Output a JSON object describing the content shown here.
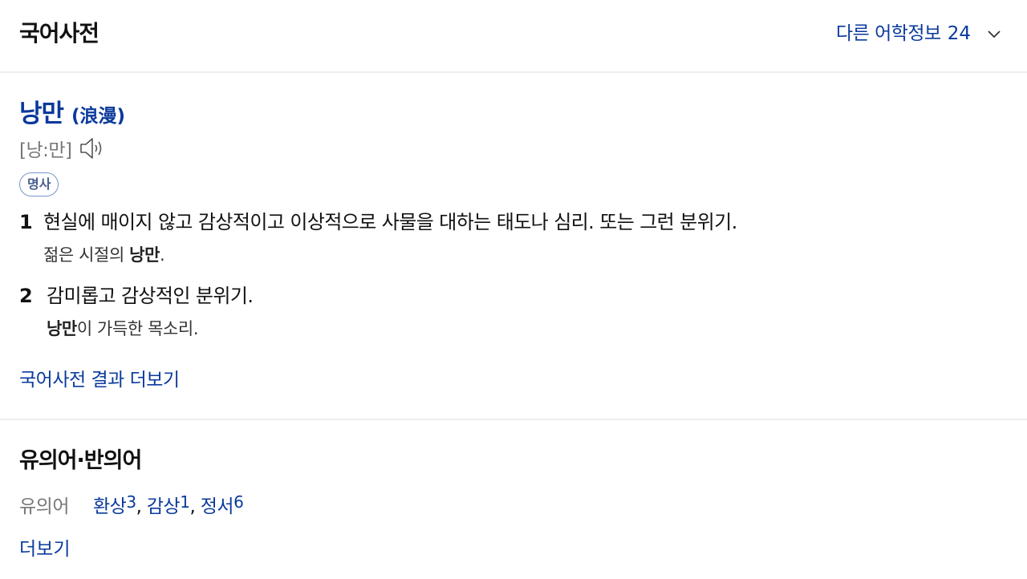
{
  "header": {
    "title": "국어사전",
    "other_info_label": "다른 어학정보",
    "other_info_count": "24"
  },
  "entry": {
    "headword": "낭만",
    "hanja": "(浪漫)",
    "pronunciation": "[낭:만]",
    "part_of_speech": "명사",
    "senses": [
      {
        "number": "1",
        "definition": "현실에 매이지 않고 감상적이고 이상적으로 사물을 대하는 태도나 심리. 또는 그런 분위기.",
        "example_before": "젊은 시절의 ",
        "example_bold": "낭만",
        "example_after": "."
      },
      {
        "number": "2",
        "definition": "감미롭고 감상적인 분위기.",
        "example_before": "",
        "example_bold": "낭만",
        "example_after": "이 가득한 목소리."
      }
    ],
    "more_results": "국어사전 결과 더보기"
  },
  "synonyms": {
    "section_title": "유의어·반의어",
    "label": "유의어",
    "items": [
      {
        "word": "환상",
        "sup": "3"
      },
      {
        "word": "감상",
        "sup": "1"
      },
      {
        "word": "정서",
        "sup": "6"
      }
    ],
    "separator": ",",
    "more": "더보기"
  },
  "colors": {
    "link_blue": "#0a3a9c",
    "divider": "#eceef1",
    "muted_gray": "#777777"
  },
  "icons": {
    "expand": "chevron-down-icon",
    "audio": "speaker-icon"
  }
}
